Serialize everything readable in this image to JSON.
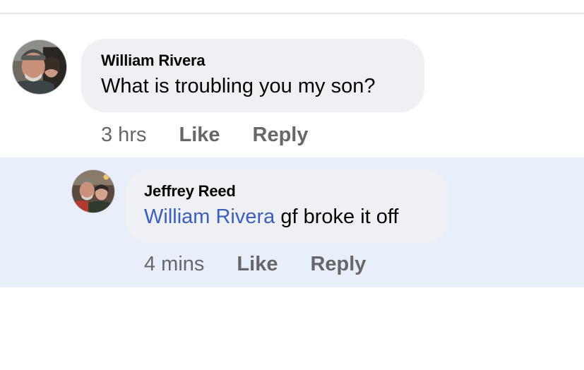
{
  "comment": {
    "author": "William Rivera",
    "text": "What is troubling you my son?",
    "time": "3 hrs",
    "like_label": "Like",
    "reply_label": "Reply"
  },
  "reply": {
    "author": "Jeffrey Reed",
    "mention": "William Rivera",
    "text": "gf broke it off",
    "time": "4 mins",
    "like_label": "Like",
    "reply_label": "Reply",
    "highlight_color": "#e8effb"
  },
  "colors": {
    "bubble": "#eef0f3",
    "mention": "#3b5fbd",
    "meta": "#65676b"
  },
  "icons": {
    "comment_avatar": "user-avatar-photo",
    "reply_avatar": "user-avatar-photo"
  }
}
